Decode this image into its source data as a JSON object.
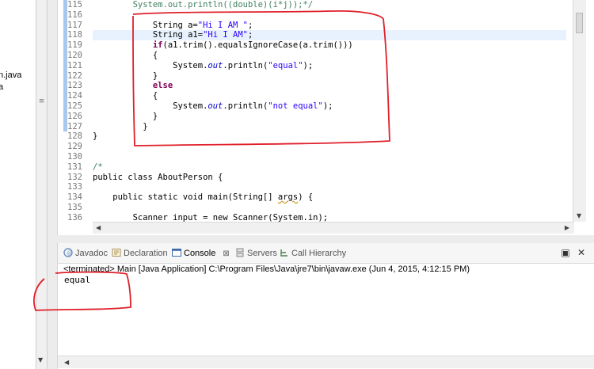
{
  "left_panel": {
    "fragments": [
      "n.java",
      "a"
    ]
  },
  "editor": {
    "lines": [
      {
        "n": "115",
        "segments": [
          [
            "cm",
            "        System.out.println((double)(i*j));*/"
          ]
        ]
      },
      {
        "n": "116",
        "segments": [
          [
            "",
            ""
          ]
        ]
      },
      {
        "n": "117",
        "segments": [
          [
            "",
            "            String a="
          ],
          [
            "str",
            "\"Hi I AM \""
          ],
          [
            "",
            ";"
          ]
        ]
      },
      {
        "n": "118",
        "segments": [
          [
            "",
            "            String a1="
          ],
          [
            "str",
            "\"Hi I AM\""
          ],
          [
            "",
            ";"
          ]
        ]
      },
      {
        "n": "119",
        "segments": [
          [
            "",
            "            "
          ],
          [
            "kw",
            "if"
          ],
          [
            "",
            "(a1.trim().equalsIgnoreCase(a.trim()))"
          ]
        ]
      },
      {
        "n": "120",
        "segments": [
          [
            "",
            "            {"
          ]
        ]
      },
      {
        "n": "121",
        "segments": [
          [
            "",
            "                System."
          ],
          [
            "it",
            "out"
          ],
          [
            "",
            ".println("
          ],
          [
            "str",
            "\"equal\""
          ],
          [
            "",
            ");"
          ]
        ]
      },
      {
        "n": "122",
        "segments": [
          [
            "",
            "            }"
          ]
        ]
      },
      {
        "n": "123",
        "segments": [
          [
            "",
            "            "
          ],
          [
            "kw",
            "else"
          ]
        ]
      },
      {
        "n": "124",
        "segments": [
          [
            "",
            "            {"
          ]
        ]
      },
      {
        "n": "125",
        "segments": [
          [
            "",
            "                System."
          ],
          [
            "it",
            "out"
          ],
          [
            "",
            ".println("
          ],
          [
            "str",
            "\"not equal\""
          ],
          [
            "",
            ");"
          ]
        ]
      },
      {
        "n": "126",
        "segments": [
          [
            "",
            "            }"
          ]
        ]
      },
      {
        "n": "127",
        "segments": [
          [
            "",
            "          }"
          ]
        ]
      },
      {
        "n": "128",
        "segments": [
          [
            "",
            "}"
          ]
        ]
      },
      {
        "n": "129",
        "segments": [
          [
            "",
            ""
          ]
        ]
      },
      {
        "n": "130",
        "segments": [
          [
            "",
            ""
          ]
        ]
      },
      {
        "n": "131",
        "segments": [
          [
            "cm",
            "/*"
          ]
        ]
      },
      {
        "n": "132",
        "segments": [
          [
            "",
            "public class AboutPerson {"
          ]
        ]
      },
      {
        "n": "133",
        "segments": [
          [
            "",
            ""
          ]
        ]
      },
      {
        "n": "134",
        "segments": [
          [
            "",
            "    public static void main(String[] "
          ],
          [
            "squig",
            "args"
          ],
          [
            "",
            ") {"
          ]
        ]
      },
      {
        "n": "135",
        "segments": [
          [
            "",
            ""
          ]
        ]
      },
      {
        "n": "136",
        "segments": [
          [
            "",
            "        Scanner input = new Scanner(System.in);"
          ]
        ]
      }
    ]
  },
  "console": {
    "tabs": [
      {
        "label": "Javadoc",
        "icon": "javadoc-icon",
        "active": false
      },
      {
        "label": "Declaration",
        "icon": "declaration-icon",
        "active": false
      },
      {
        "label": "Console",
        "icon": "console-icon",
        "active": true
      },
      {
        "label": "Servers",
        "icon": "servers-icon",
        "active": false
      },
      {
        "label": "Call Hierarchy",
        "icon": "call-hierarchy-icon",
        "active": false
      }
    ],
    "close_glyph": "✕",
    "header": "<terminated> Main [Java Application] C:\\Program Files\\Java\\jre7\\bin\\javaw.exe (Jun 4, 2015, 4:12:15 PM)",
    "output": "equal"
  },
  "colors": {
    "annotation": "#e0202a",
    "keyword": "#7f0055",
    "string": "#2a00ff",
    "comment": "#3f7f5f",
    "change_bar": "#a6c8ee"
  }
}
